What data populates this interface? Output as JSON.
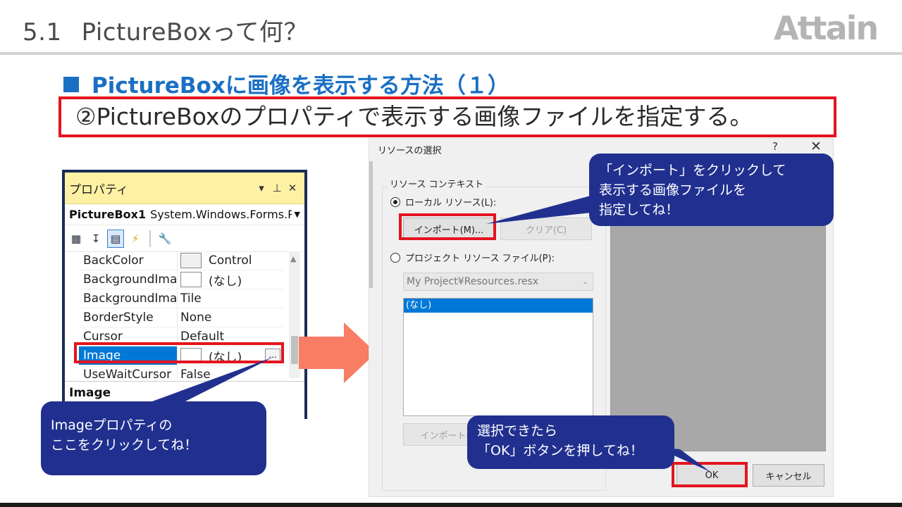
{
  "slide": {
    "number": "5.1",
    "title": "PictureBoxって何？",
    "logo_text": "Attain",
    "heading": "PictureBoxに画像を表示する方法（１）",
    "step": "②PictureBoxのプロパティで表示する画像ファイルを指定する。"
  },
  "properties_panel": {
    "title": "プロパティ",
    "header_buttons": [
      "▼",
      "ㅍ",
      "✕"
    ],
    "object_name": "PictureBox1",
    "object_type": "System.Windows.Forms.P",
    "rows": [
      {
        "name": "BackColor",
        "value": "Control",
        "swatch": true
      },
      {
        "name": "BackgroundImag",
        "value": "(なし)",
        "swatch": true
      },
      {
        "name": "BackgroundImag",
        "value": "Tile",
        "swatch": false
      },
      {
        "name": "BorderStyle",
        "value": "None",
        "swatch": false
      },
      {
        "name": "Cursor",
        "value": "Default",
        "swatch": false
      },
      {
        "name": "Image",
        "value": "(なし)",
        "swatch": true,
        "selected": true
      },
      {
        "name": "UseWaitCursor",
        "value": "False",
        "swatch": false
      }
    ],
    "ellipsis": "...",
    "description": "Image"
  },
  "dialog": {
    "title": "リソースの選択",
    "help": "?",
    "close": "✕",
    "group_label": "リソース コンテキスト",
    "local_radio": "ローカル リソース(L):",
    "import_button": "インポート(M)...",
    "clear_button": "クリア(C)",
    "project_radio": "プロジェクト リソース ファイル(P):",
    "combo_value": "My Project¥Resources.resx",
    "list_item": "(なし)",
    "import2_button": "インポート(M",
    "ok_button": "OK",
    "cancel_button": "キャンセル"
  },
  "callouts": {
    "import": [
      "「インポート」をクリックして",
      "表示する画像ファイルを",
      "指定してね！"
    ],
    "image": [
      "Imageプロパティの",
      "ここをクリックしてね！"
    ],
    "ok": [
      "選択できたら",
      "「OK」ボタンを押してね！"
    ]
  },
  "colors": {
    "heading_blue": "#1a6fc4",
    "highlight_red": "#e3141f",
    "callout_navy": "#21308f",
    "arrow_salmon": "#f97c64",
    "selection_blue": "#0078d7"
  }
}
